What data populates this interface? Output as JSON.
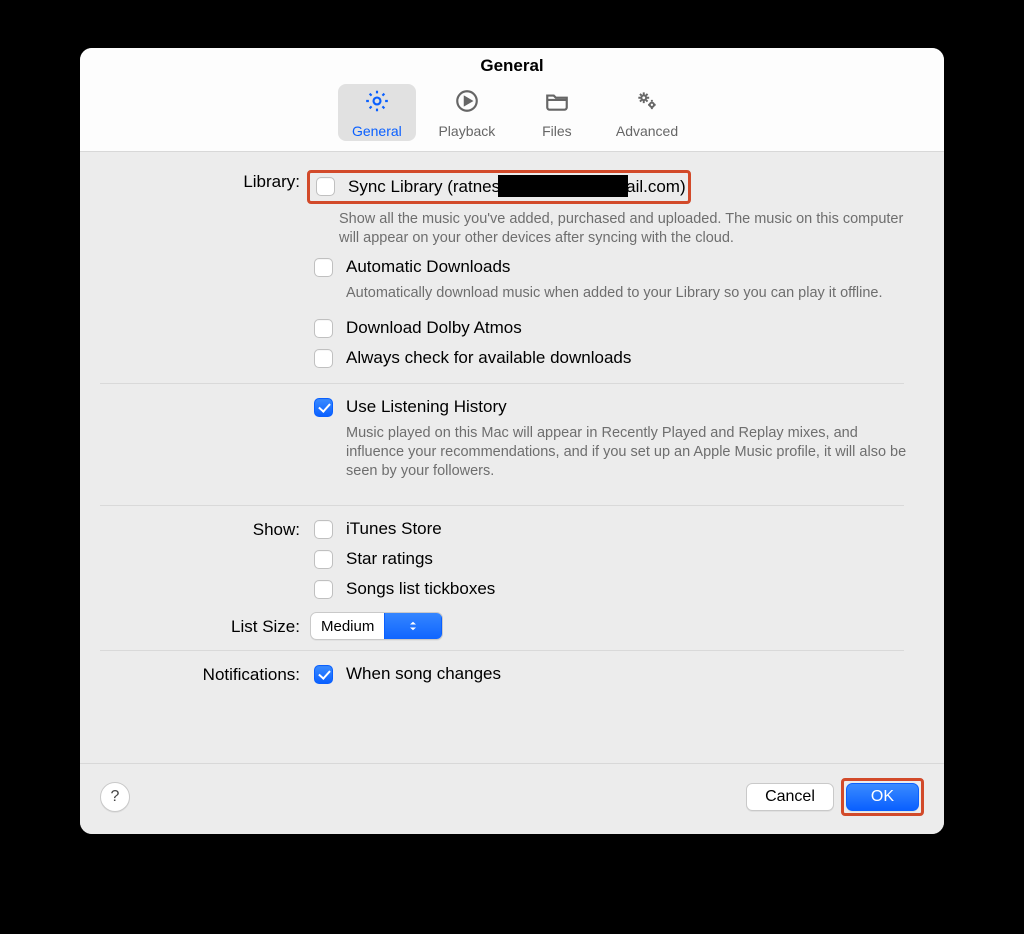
{
  "window_title": "General",
  "tabs": [
    {
      "id": "general",
      "label": "General",
      "icon": "gear",
      "active": true
    },
    {
      "id": "playback",
      "label": "Playback",
      "icon": "play",
      "active": false
    },
    {
      "id": "files",
      "label": "Files",
      "icon": "folder",
      "active": false
    },
    {
      "id": "advanced",
      "label": "Advanced",
      "icon": "gears",
      "active": false
    }
  ],
  "library": {
    "section_label": "Library:",
    "sync": {
      "label_pre": "Sync Library (ratnes",
      "label_post": "ail.com)",
      "checked": false,
      "desc": "Show all the music you've added, purchased and uploaded. The music on this computer will appear on your other devices after syncing with the cloud."
    },
    "auto_downloads": {
      "label": "Automatic Downloads",
      "checked": false,
      "desc": "Automatically download music when added to your Library so you can play it offline."
    },
    "dolby": {
      "label": "Download Dolby Atmos",
      "checked": false
    },
    "always_check": {
      "label": "Always check for available downloads",
      "checked": false
    }
  },
  "listening": {
    "label": "Use Listening History",
    "checked": true,
    "desc": "Music played on this Mac will appear in Recently Played and Replay mixes, and influence your recommendations, and if you set up an Apple Music profile, it will also be seen by your followers."
  },
  "show": {
    "section_label": "Show:",
    "itunes": {
      "label": "iTunes Store",
      "checked": false
    },
    "stars": {
      "label": "Star ratings",
      "checked": false
    },
    "ticks": {
      "label": "Songs list tickboxes",
      "checked": false
    }
  },
  "list_size": {
    "section_label": "List Size:",
    "value": "Medium"
  },
  "notifications": {
    "section_label": "Notifications:",
    "song_changes": {
      "label": "When song changes",
      "checked": true
    }
  },
  "footer": {
    "help_tooltip": "Help",
    "cancel": "Cancel",
    "ok": "OK"
  },
  "colors": {
    "accent": "#0a60ff",
    "highlight": "#d24a2a"
  }
}
